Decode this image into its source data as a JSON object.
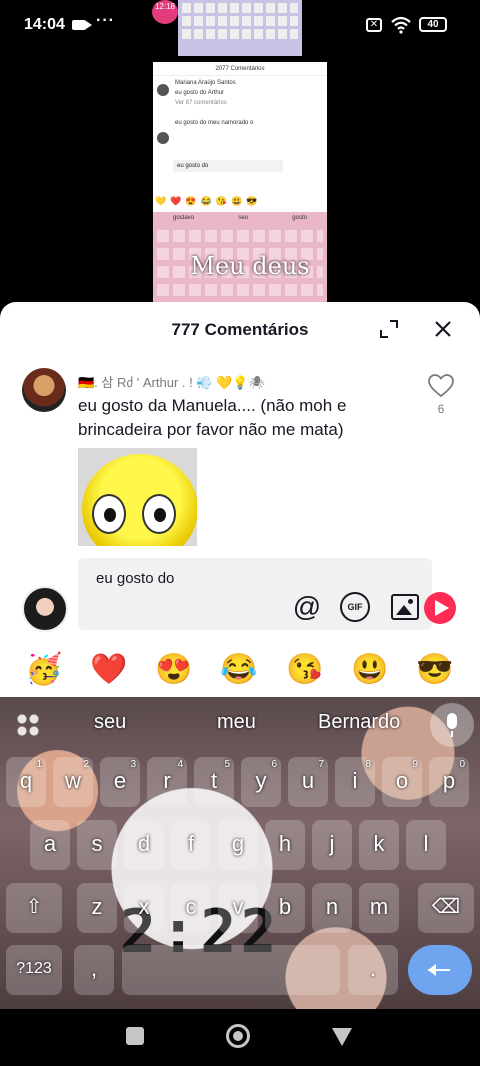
{
  "status_bar": {
    "time": "14:04",
    "dots": "···",
    "battery": "40"
  },
  "video": {
    "badge_time": "12:18",
    "mini_title": "2077 Comentários",
    "mini_user1": "Mariana Araújo Santos",
    "mini_text1": "eu gosto do Arthur",
    "mini_reply": "Ver 87 comentários",
    "mini_text2": "eu gosto do meu namorado o",
    "mini_input": "eu gosto do",
    "mini_suggestions": [
      "gostavo",
      "seu",
      "gosto"
    ],
    "caption": "Meu deus"
  },
  "sheet": {
    "title": "777 Comentários"
  },
  "comment": {
    "username": "🇩🇪. 삼 Rძ ' Arthur . ! 💨 💛💡🕷",
    "text": "eu gosto da Manuela.... (não moh e brincadeira por favor não me mata)",
    "like_count": "6"
  },
  "input": {
    "value": "eu gosto do",
    "at_symbol": "@",
    "gif_label": "GIF"
  },
  "emojis": [
    "🥳",
    "❤️",
    "😍",
    "😂",
    "😘",
    "😃",
    "😎"
  ],
  "emoji_names": [
    "party-emoji",
    "heart-emoji",
    "heart-eyes-emoji",
    "joy-emoji",
    "kiss-emoji",
    "smile-emoji",
    "sunglasses-emoji"
  ],
  "keyboard": {
    "suggestions": [
      "seu",
      "meu",
      "Bernardo"
    ],
    "row1": [
      "q",
      "w",
      "e",
      "r",
      "t",
      "y",
      "u",
      "i",
      "o",
      "p"
    ],
    "row1_hints": [
      "1",
      "2",
      "3",
      "4",
      "5",
      "6",
      "7",
      "8",
      "9",
      "0"
    ],
    "row2": [
      "a",
      "s",
      "d",
      "f",
      "g",
      "h",
      "j",
      "k",
      "l"
    ],
    "row3": [
      "z",
      "x",
      "c",
      "v",
      "b",
      "n",
      "m"
    ],
    "shift": "⇧",
    "delete": "⌫",
    "symbols": "?123",
    "comma": ",",
    "space": "",
    "period": ".",
    "overlay_text": "2:22"
  }
}
